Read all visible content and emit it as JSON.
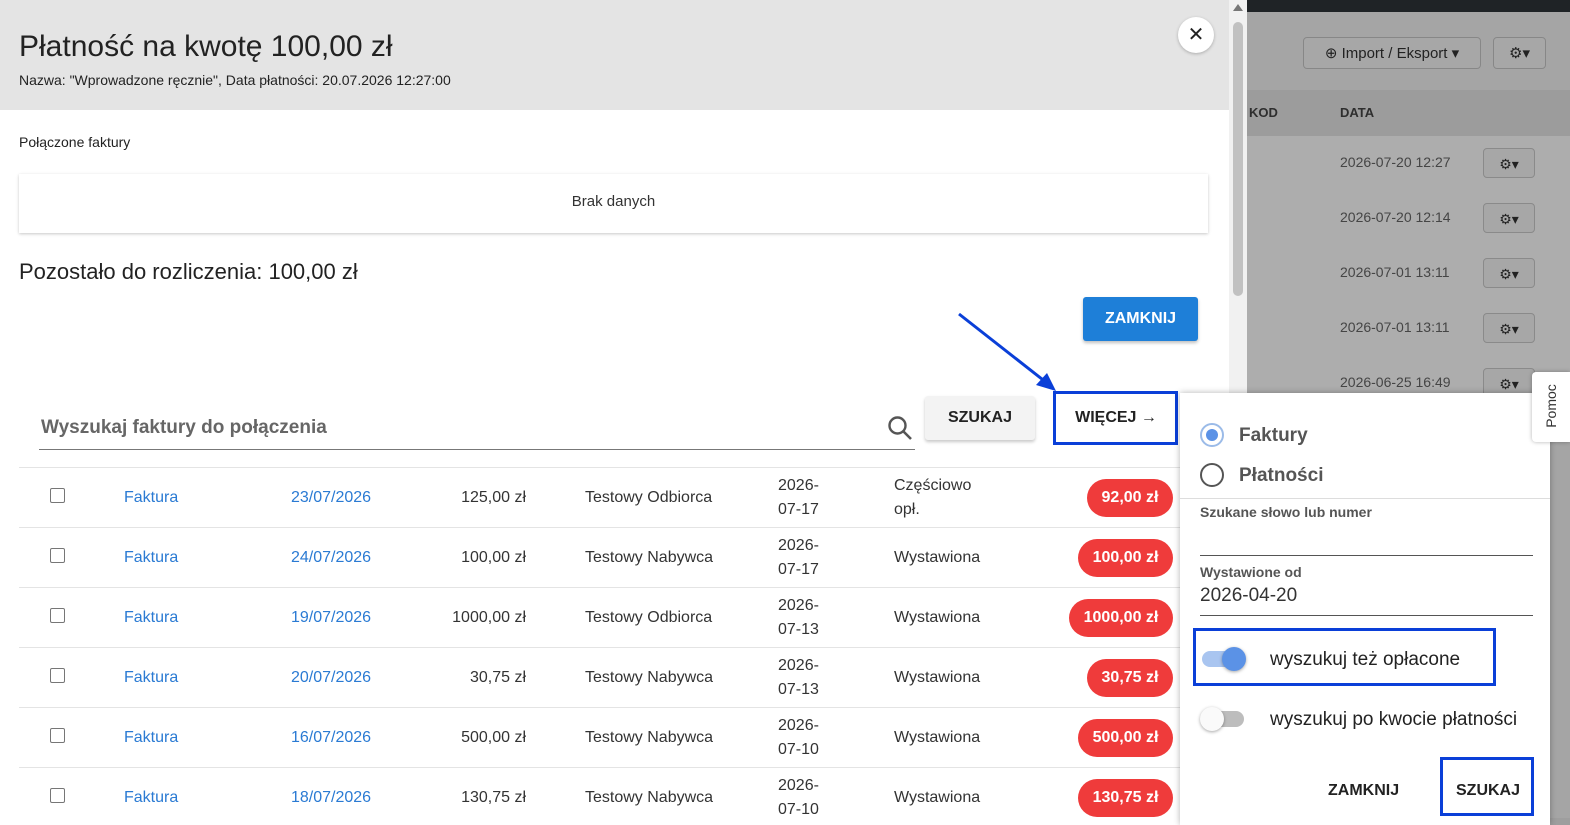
{
  "background": {
    "import_export_label": "Import / Eksport",
    "columns": [
      "KOD",
      "DATA"
    ],
    "rows": [
      {
        "date": "2026-07-20 12:27"
      },
      {
        "date": "2026-07-20 12:14"
      },
      {
        "date": "2026-07-01 13:11"
      },
      {
        "date": "2026-07-01 13:11"
      },
      {
        "date": "2026-06-25 16:49"
      }
    ]
  },
  "modal": {
    "title": "Płatność na kwotę 100,00 zł",
    "subtitle": "Nazwa: \"Wprowadzone ręcznie\", Data płatności: 20.07.2026 12:27:00",
    "linked_label": "Połączone faktury",
    "empty_text": "Brak danych",
    "remaining": "Pozostało do rozliczenia: 100,00 zł",
    "close_label": "ZAMKNIJ",
    "search_placeholder": "Wyszukaj faktury do połączenia",
    "search_button": "SZUKAJ",
    "more_button": "WIĘCEJ →"
  },
  "invoices": [
    {
      "type": "Faktura",
      "number": "23/07/2026",
      "amount": "125,00 zł",
      "party": "Testowy Odbiorca",
      "date_line1": "2026-",
      "date_line2": "07-17",
      "status_line1": "Częściowo",
      "status_line2": "opł.",
      "due": "92,00 zł"
    },
    {
      "type": "Faktura",
      "number": "24/07/2026",
      "amount": "100,00 zł",
      "party": "Testowy Nabywca",
      "date_line1": "2026-",
      "date_line2": "07-17",
      "status_line1": "Wystawiona",
      "status_line2": "",
      "due": "100,00 zł"
    },
    {
      "type": "Faktura",
      "number": "19/07/2026",
      "amount": "1000,00 zł",
      "party": "Testowy Odbiorca",
      "date_line1": "2026-",
      "date_line2": "07-13",
      "status_line1": "Wystawiona",
      "status_line2": "",
      "due": "1000,00 zł"
    },
    {
      "type": "Faktura",
      "number": "20/07/2026",
      "amount": "30,75 zł",
      "party": "Testowy Nabywca",
      "date_line1": "2026-",
      "date_line2": "07-13",
      "status_line1": "Wystawiona",
      "status_line2": "",
      "due": "30,75 zł"
    },
    {
      "type": "Faktura",
      "number": "16/07/2026",
      "amount": "500,00 zł",
      "party": "Testowy Nabywca",
      "date_line1": "2026-",
      "date_line2": "07-10",
      "status_line1": "Wystawiona",
      "status_line2": "",
      "due": "500,00 zł"
    },
    {
      "type": "Faktura",
      "number": "18/07/2026",
      "amount": "130,75 zł",
      "party": "Testowy Nabywca",
      "date_line1": "2026-",
      "date_line2": "07-10",
      "status_line1": "Wystawiona",
      "status_line2": "",
      "due": "130,75 zł"
    }
  ],
  "panel": {
    "radio_invoices": "Faktury",
    "radio_payments": "Płatności",
    "search_term_label": "Szukane słowo lub numer",
    "search_term_value": "",
    "issued_from_label": "Wystawione od",
    "issued_from_value": "2026-04-20",
    "toggle_paid_label": "wyszukuj też opłacone",
    "toggle_paid_on": true,
    "toggle_amount_label": "wyszukuj po kwocie płatności",
    "toggle_amount_on": false,
    "close_label": "ZAMKNIJ",
    "search_label": "SZUKAJ"
  },
  "help_tab": "Pomoc",
  "colors": {
    "primary": "#1e7fd8",
    "badge_red": "#ef3b3b",
    "link_blue": "#2a7ad3",
    "annotation_blue": "#0a3fd8",
    "toggle_on": "#5b92e6"
  }
}
